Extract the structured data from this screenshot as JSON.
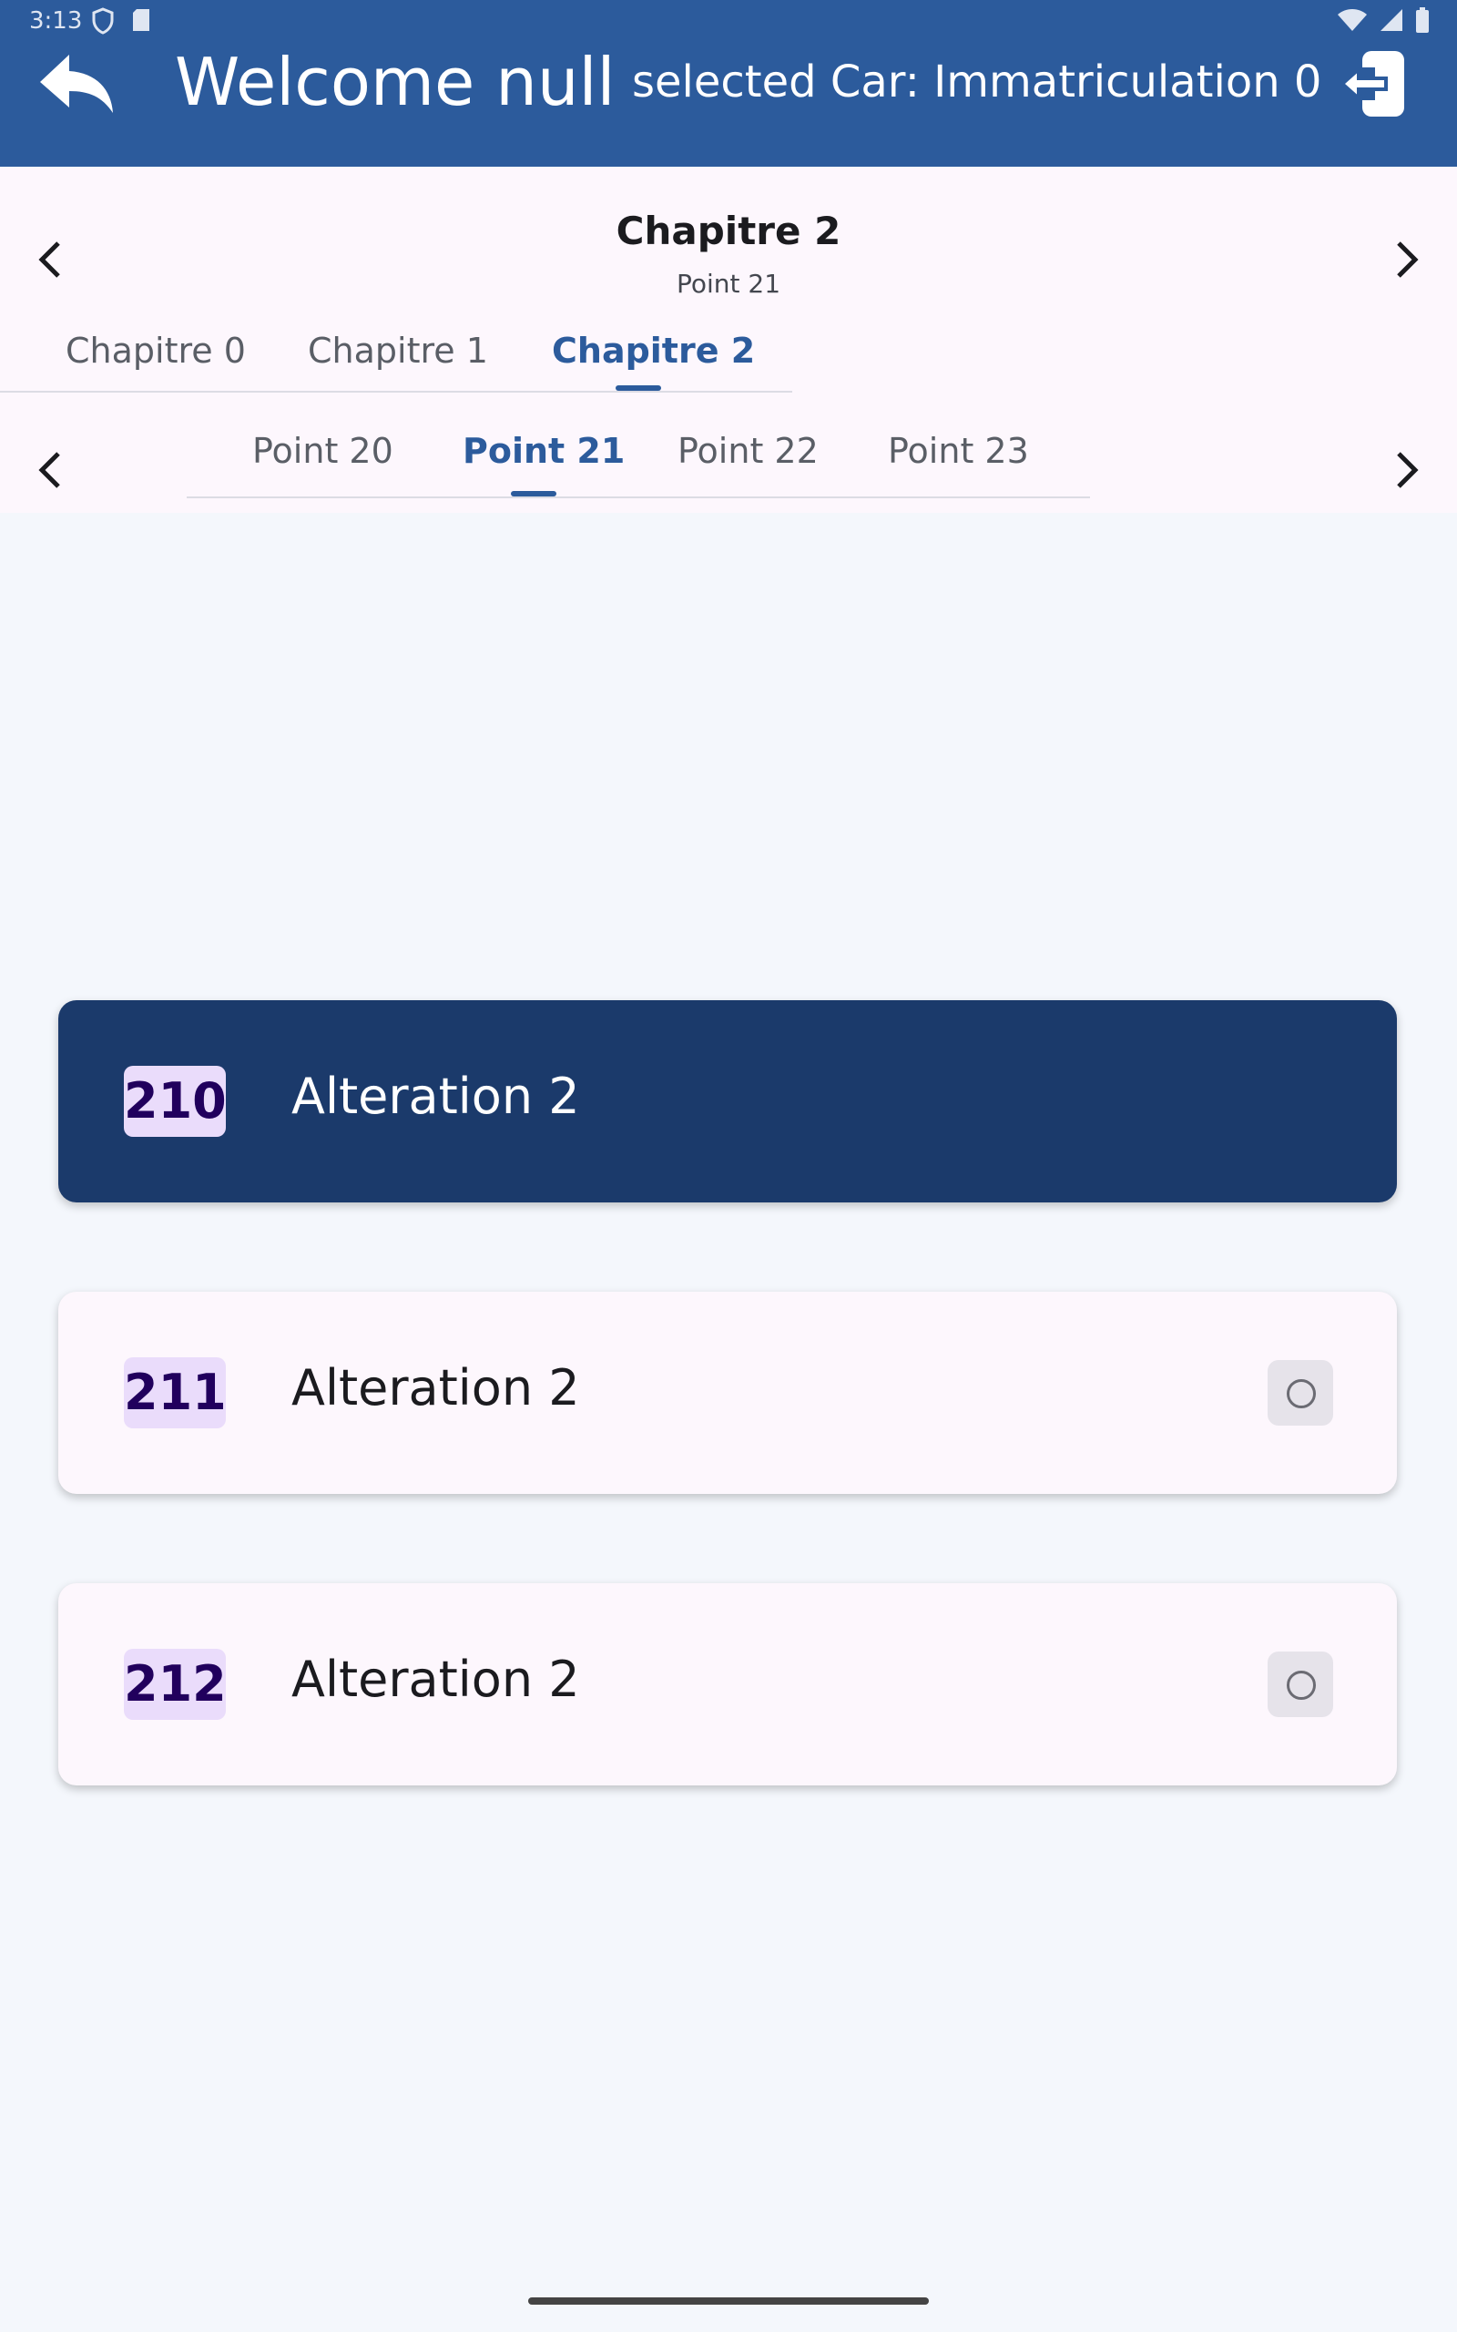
{
  "status_bar": {
    "time": "3:13"
  },
  "app_bar": {
    "welcome": "Welcome null",
    "selected_car": "selected Car: Immatriculation 0",
    "color": "#2c5b9c"
  },
  "chapter_header": {
    "title": "Chapitre 2",
    "subtitle": "Point 21"
  },
  "chapter_tabs": [
    {
      "label": "Chapitre 0",
      "active": false
    },
    {
      "label": "Chapitre 1",
      "active": false
    },
    {
      "label": "Chapitre 2",
      "active": true
    }
  ],
  "point_tabs": [
    {
      "label": "Point 20",
      "active": false
    },
    {
      "label": "Point 21",
      "active": true
    },
    {
      "label": "Point 22",
      "active": false
    },
    {
      "label": "Point 23",
      "active": false
    }
  ],
  "items": [
    {
      "number": "210",
      "label": "Alteration 2",
      "selected": true
    },
    {
      "number": "211",
      "label": "Alteration 2",
      "selected": false
    },
    {
      "number": "212",
      "label": "Alteration 2",
      "selected": false
    }
  ],
  "colors": {
    "accent": "#2c5b9c",
    "selected_card": "#1b3a6b",
    "badge_bg": "#eadcfb"
  }
}
